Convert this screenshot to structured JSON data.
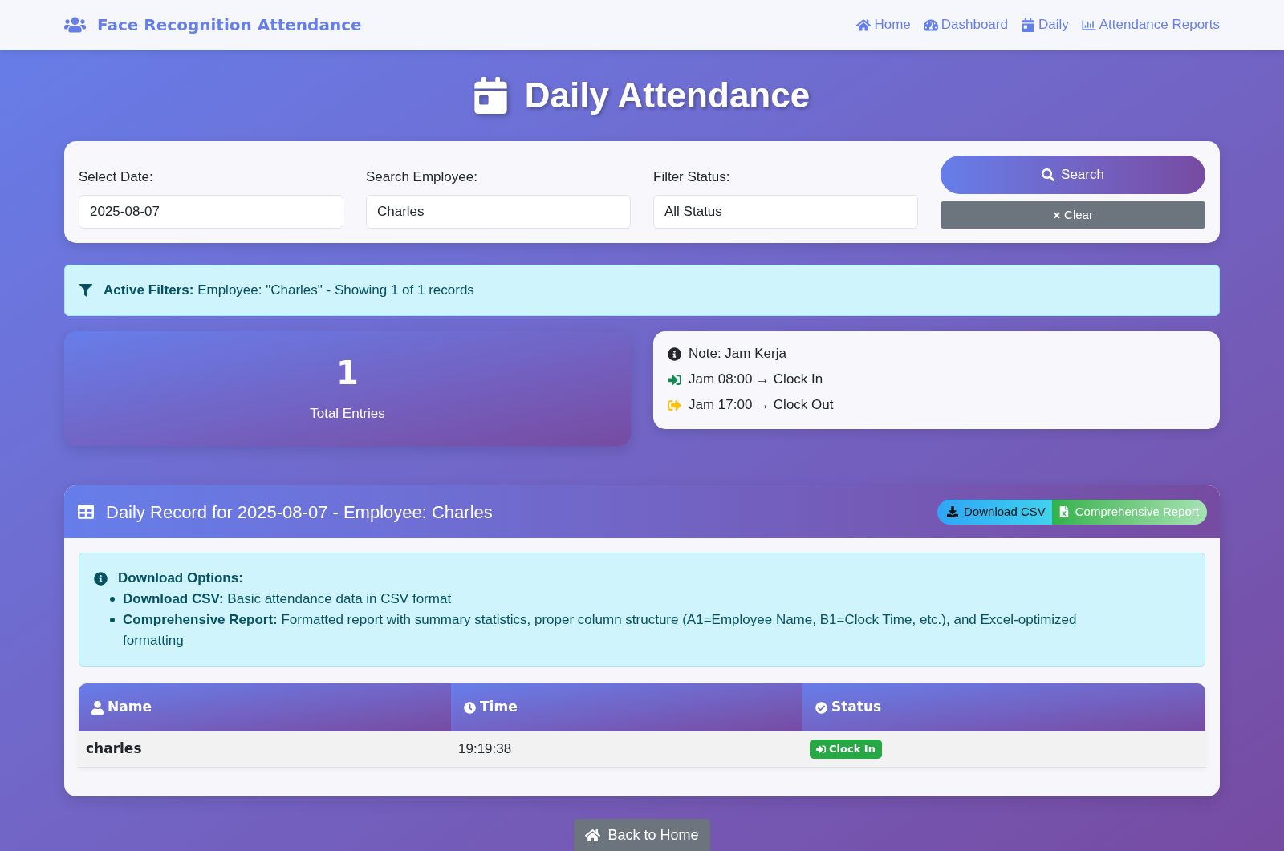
{
  "navbar": {
    "brand": "Face Recognition Attendance",
    "links": [
      {
        "label": "Home"
      },
      {
        "label": "Dashboard"
      },
      {
        "label": "Daily"
      },
      {
        "label": "Attendance Reports"
      }
    ]
  },
  "page_title": "Daily Attendance",
  "filters": {
    "fields": [
      {
        "label": "Select Date:",
        "value": "2025-08-07"
      },
      {
        "label": "Search Employee:",
        "value": "Charles"
      },
      {
        "label": "Filter Status:",
        "value": "All Status"
      }
    ],
    "search_button": "Search",
    "clear_button": "Clear"
  },
  "active_filters": "**Active Filters:** Employee: \"Charles\" - Showing 1 of 1 records",
  "stats": {
    "value": "1",
    "label": "Total Entries"
  },
  "note": {
    "lines": [
      {
        "kind": "info",
        "text": "Note: Jam Kerja"
      },
      {
        "kind": "clock_in",
        "text": "Jam 08:00 → Clock In"
      },
      {
        "kind": "clock_out",
        "text": "Jam 17:00 → Clock Out"
      }
    ]
  },
  "record": {
    "title": "Daily Record for 2025-08-07 - Employee: Charles",
    "buttons": [
      {
        "kind": "csv",
        "label": "Download CSV"
      },
      {
        "kind": "report",
        "label": "Comprehensive Report"
      }
    ],
    "download_options": {
      "title": "Download Options:",
      "items": [
        "**Download CSV:** Basic attendance data in CSV format",
        "**Comprehensive Report:** Formatted report with summary statistics, proper column structure (A1=Employee Name, B1=Clock Time, etc.), and Excel-optimized formatting"
      ]
    },
    "table": {
      "columns": [
        "Name",
        "Time",
        "Status"
      ],
      "rows": [
        {
          "name": "charles",
          "time": "19:19:38",
          "status": {
            "kind": "clock_in",
            "label": "Clock In"
          }
        }
      ]
    }
  },
  "back_button": "Back to Home"
}
